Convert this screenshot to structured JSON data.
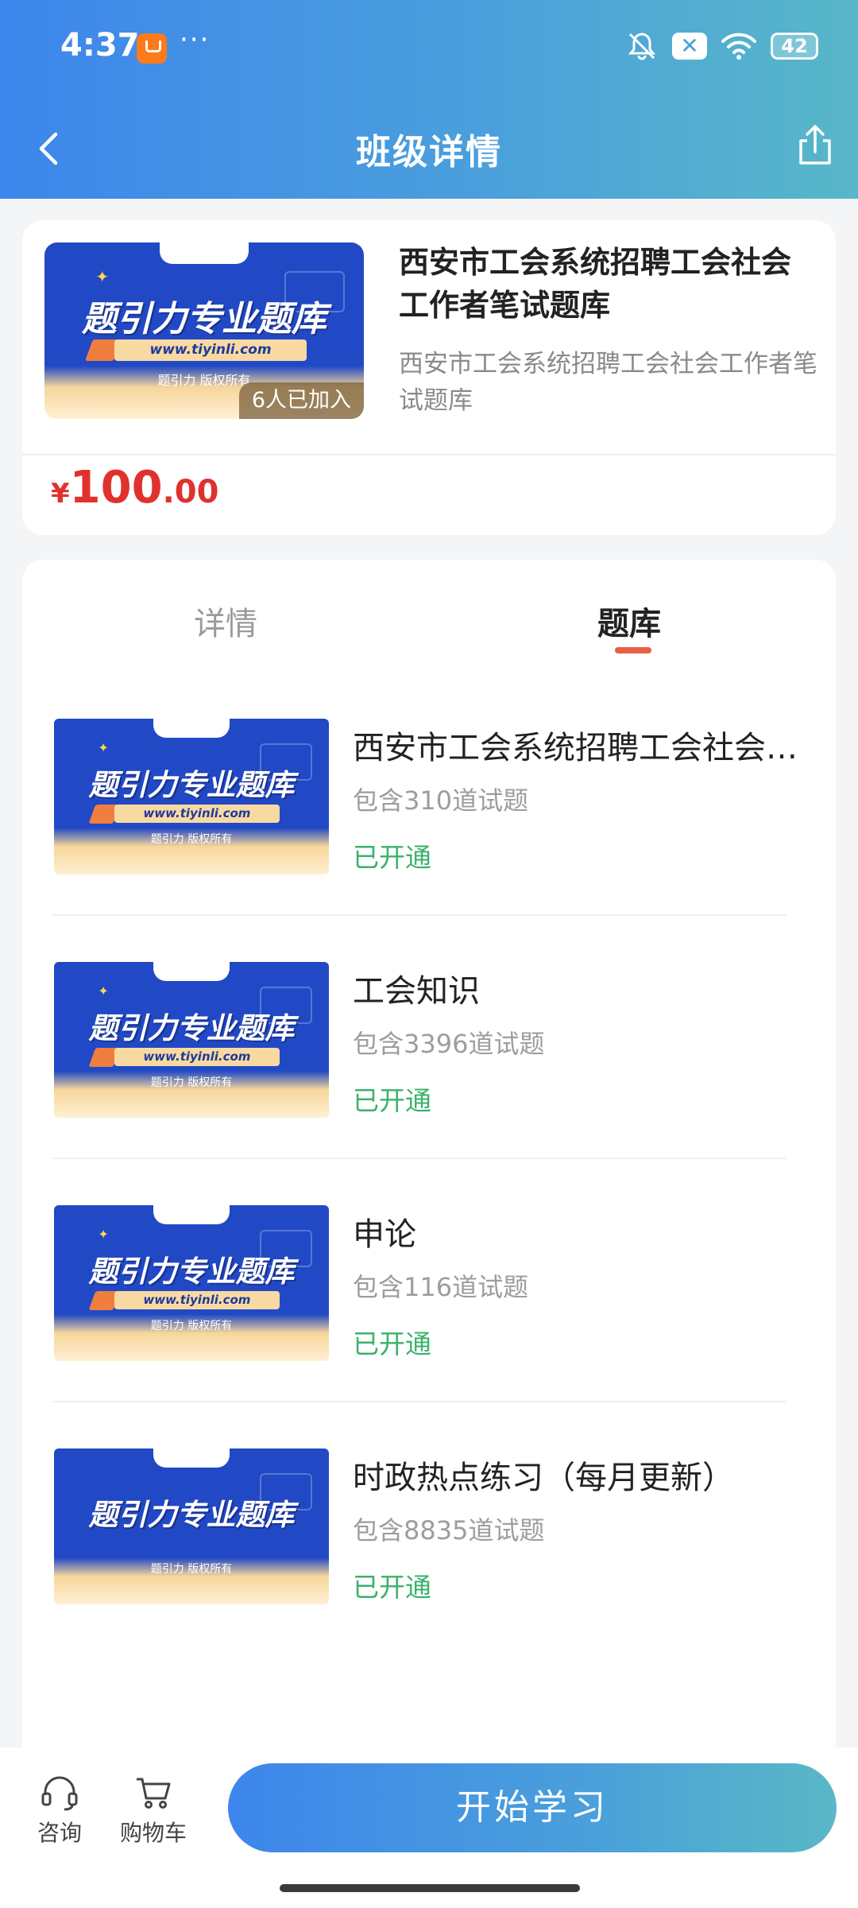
{
  "status_bar": {
    "time": "4:37",
    "more": "···",
    "battery": "42"
  },
  "header": {
    "title": "班级详情"
  },
  "course": {
    "title": "西安市工会系统招聘工会社会工作者笔试题库",
    "subtitle": "西安市工会系统招聘工会社会工作者笔试题库",
    "joined": "6人已加入",
    "price_symbol": "¥",
    "price_integer": "100",
    "price_decimal": ".00",
    "cover": {
      "brand": "题引力",
      "headline": "题引力专业题库",
      "url": "www.tiyinli.com",
      "footer": "题引力 版权所有"
    }
  },
  "tabs": [
    {
      "label": "详情",
      "active": false
    },
    {
      "label": "题库",
      "active": true
    }
  ],
  "banks": [
    {
      "title": "西安市工会系统招聘工会社会工作者笔试题库",
      "count": "包含310道试题",
      "status": "已开通"
    },
    {
      "title": "工会知识",
      "count": "包含3396道试题",
      "status": "已开通"
    },
    {
      "title": "申论",
      "count": "包含116道试题",
      "status": "已开通"
    },
    {
      "title": "时政热点练习（每月更新）",
      "count": "包含8835道试题",
      "status": "已开通"
    }
  ],
  "bottom": {
    "consult": "咨询",
    "cart": "购物车",
    "start": "开始学习"
  },
  "colors": {
    "accent": "#3d86ec",
    "price": "#e0322d",
    "status_ok": "#3bb26b",
    "tab_indicator": "#e85f44"
  }
}
